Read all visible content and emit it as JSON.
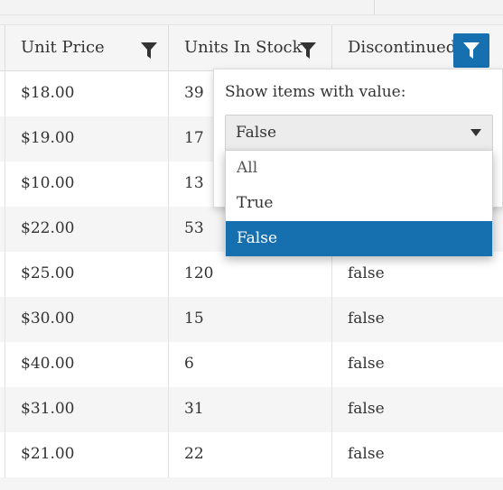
{
  "columns": [
    {
      "title": "Unit Price",
      "filter_active": false
    },
    {
      "title": "Units In Stock",
      "filter_active": false
    },
    {
      "title": "Discontinued",
      "filter_active": true
    }
  ],
  "rows": [
    {
      "unit_price": "$18.00",
      "units_in_stock": "39",
      "discontinued": ""
    },
    {
      "unit_price": "$19.00",
      "units_in_stock": "17",
      "discontinued": ""
    },
    {
      "unit_price": "$10.00",
      "units_in_stock": "13",
      "discontinued": ""
    },
    {
      "unit_price": "$22.00",
      "units_in_stock": "53",
      "discontinued": ""
    },
    {
      "unit_price": "$25.00",
      "units_in_stock": "120",
      "discontinued": "false"
    },
    {
      "unit_price": "$30.00",
      "units_in_stock": "15",
      "discontinued": "false"
    },
    {
      "unit_price": "$40.00",
      "units_in_stock": "6",
      "discontinued": "false"
    },
    {
      "unit_price": "$31.00",
      "units_in_stock": "31",
      "discontinued": "false"
    },
    {
      "unit_price": "$21.00",
      "units_in_stock": "22",
      "discontinued": "false"
    }
  ],
  "filter_popup": {
    "label": "Show items with value:",
    "selected_value": "False",
    "options": [
      "All",
      "True",
      "False"
    ],
    "selected_index": 2
  },
  "icons": {
    "filter": "filter-funnel-icon",
    "dropdown": "caret-down-icon"
  },
  "colors": {
    "accent": "#1670b0",
    "header_bg": "#f5f5f5",
    "alt_row": "#f5f5f5"
  }
}
